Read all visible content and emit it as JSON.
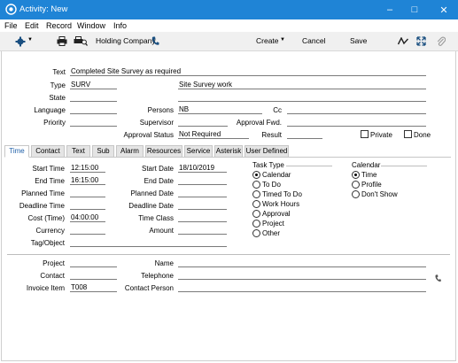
{
  "window": {
    "title": "Activity: New"
  },
  "menu": [
    "File",
    "Edit",
    "Record",
    "Window",
    "Info"
  ],
  "toolbar": {
    "company": "Holding Company",
    "create": "Create",
    "cancel": "Cancel",
    "save": "Save"
  },
  "header": {
    "text_label": "Text",
    "text_value": "Completed Site Survey as required",
    "type_label": "Type",
    "type_value": "SURV",
    "type_desc": "Site Survey work",
    "state_label": "State",
    "state_value": "",
    "language_label": "Language",
    "language_value": "",
    "persons_label": "Persons",
    "persons_value": "NB",
    "cc_label": "Cc",
    "cc_value": "",
    "priority_label": "Priority",
    "priority_value": "",
    "supervisor_label": "Supervisor",
    "supervisor_value": "",
    "approval_fwd_label": "Approval Fwd.",
    "approval_fwd_value": "",
    "approval_status_label": "Approval Status",
    "approval_status_value": "Not Required",
    "result_label": "Result",
    "result_value": "",
    "private_label": "Private",
    "done_label": "Done"
  },
  "tabs": [
    "Time",
    "Contact",
    "Text",
    "Sub",
    "Alarm",
    "Resources",
    "Service",
    "Asterisk",
    "User Defined"
  ],
  "time": {
    "start_time_label": "Start Time",
    "start_time": "12:15:00",
    "end_time_label": "End Time",
    "end_time": "16:15:00",
    "planned_time_label": "Planned Time",
    "planned_time": "",
    "deadline_time_label": "Deadline Time",
    "deadline_time": "",
    "cost_time_label": "Cost (Time)",
    "cost_time": "04:00:00",
    "currency_label": "Currency",
    "currency": "",
    "tag_label": "Tag/Object",
    "tag": "",
    "start_date_label": "Start Date",
    "start_date": "18/10/2019",
    "end_date_label": "End Date",
    "end_date": "",
    "planned_date_label": "Planned Date",
    "planned_date": "",
    "deadline_date_label": "Deadline Date",
    "deadline_date": "",
    "time_class_label": "Time Class",
    "time_class": "",
    "amount_label": "Amount",
    "amount": "",
    "task_type_label": "Task Type",
    "task_types": [
      "Calendar",
      "To Do",
      "Timed To Do",
      "Work Hours",
      "Approval",
      "Project",
      "Other"
    ],
    "task_type_selected": "Calendar",
    "calendar_label": "Calendar",
    "calendar_opts": [
      "Time",
      "Profile",
      "Don't Show"
    ],
    "calendar_selected": "Time"
  },
  "footer": {
    "project_label": "Project",
    "project": "",
    "name_label": "Name",
    "name": "",
    "contact_label": "Contact",
    "contact": "",
    "telephone_label": "Telephone",
    "telephone": "",
    "invoice_item_label": "Invoice Item",
    "invoice_item": "T008",
    "contact_person_label": "Contact Person",
    "contact_person": ""
  },
  "colors": {
    "titlebar": "#1f84d6",
    "toolbar": "#f0f0f0",
    "active_tab_text": "#1f5fa8"
  }
}
